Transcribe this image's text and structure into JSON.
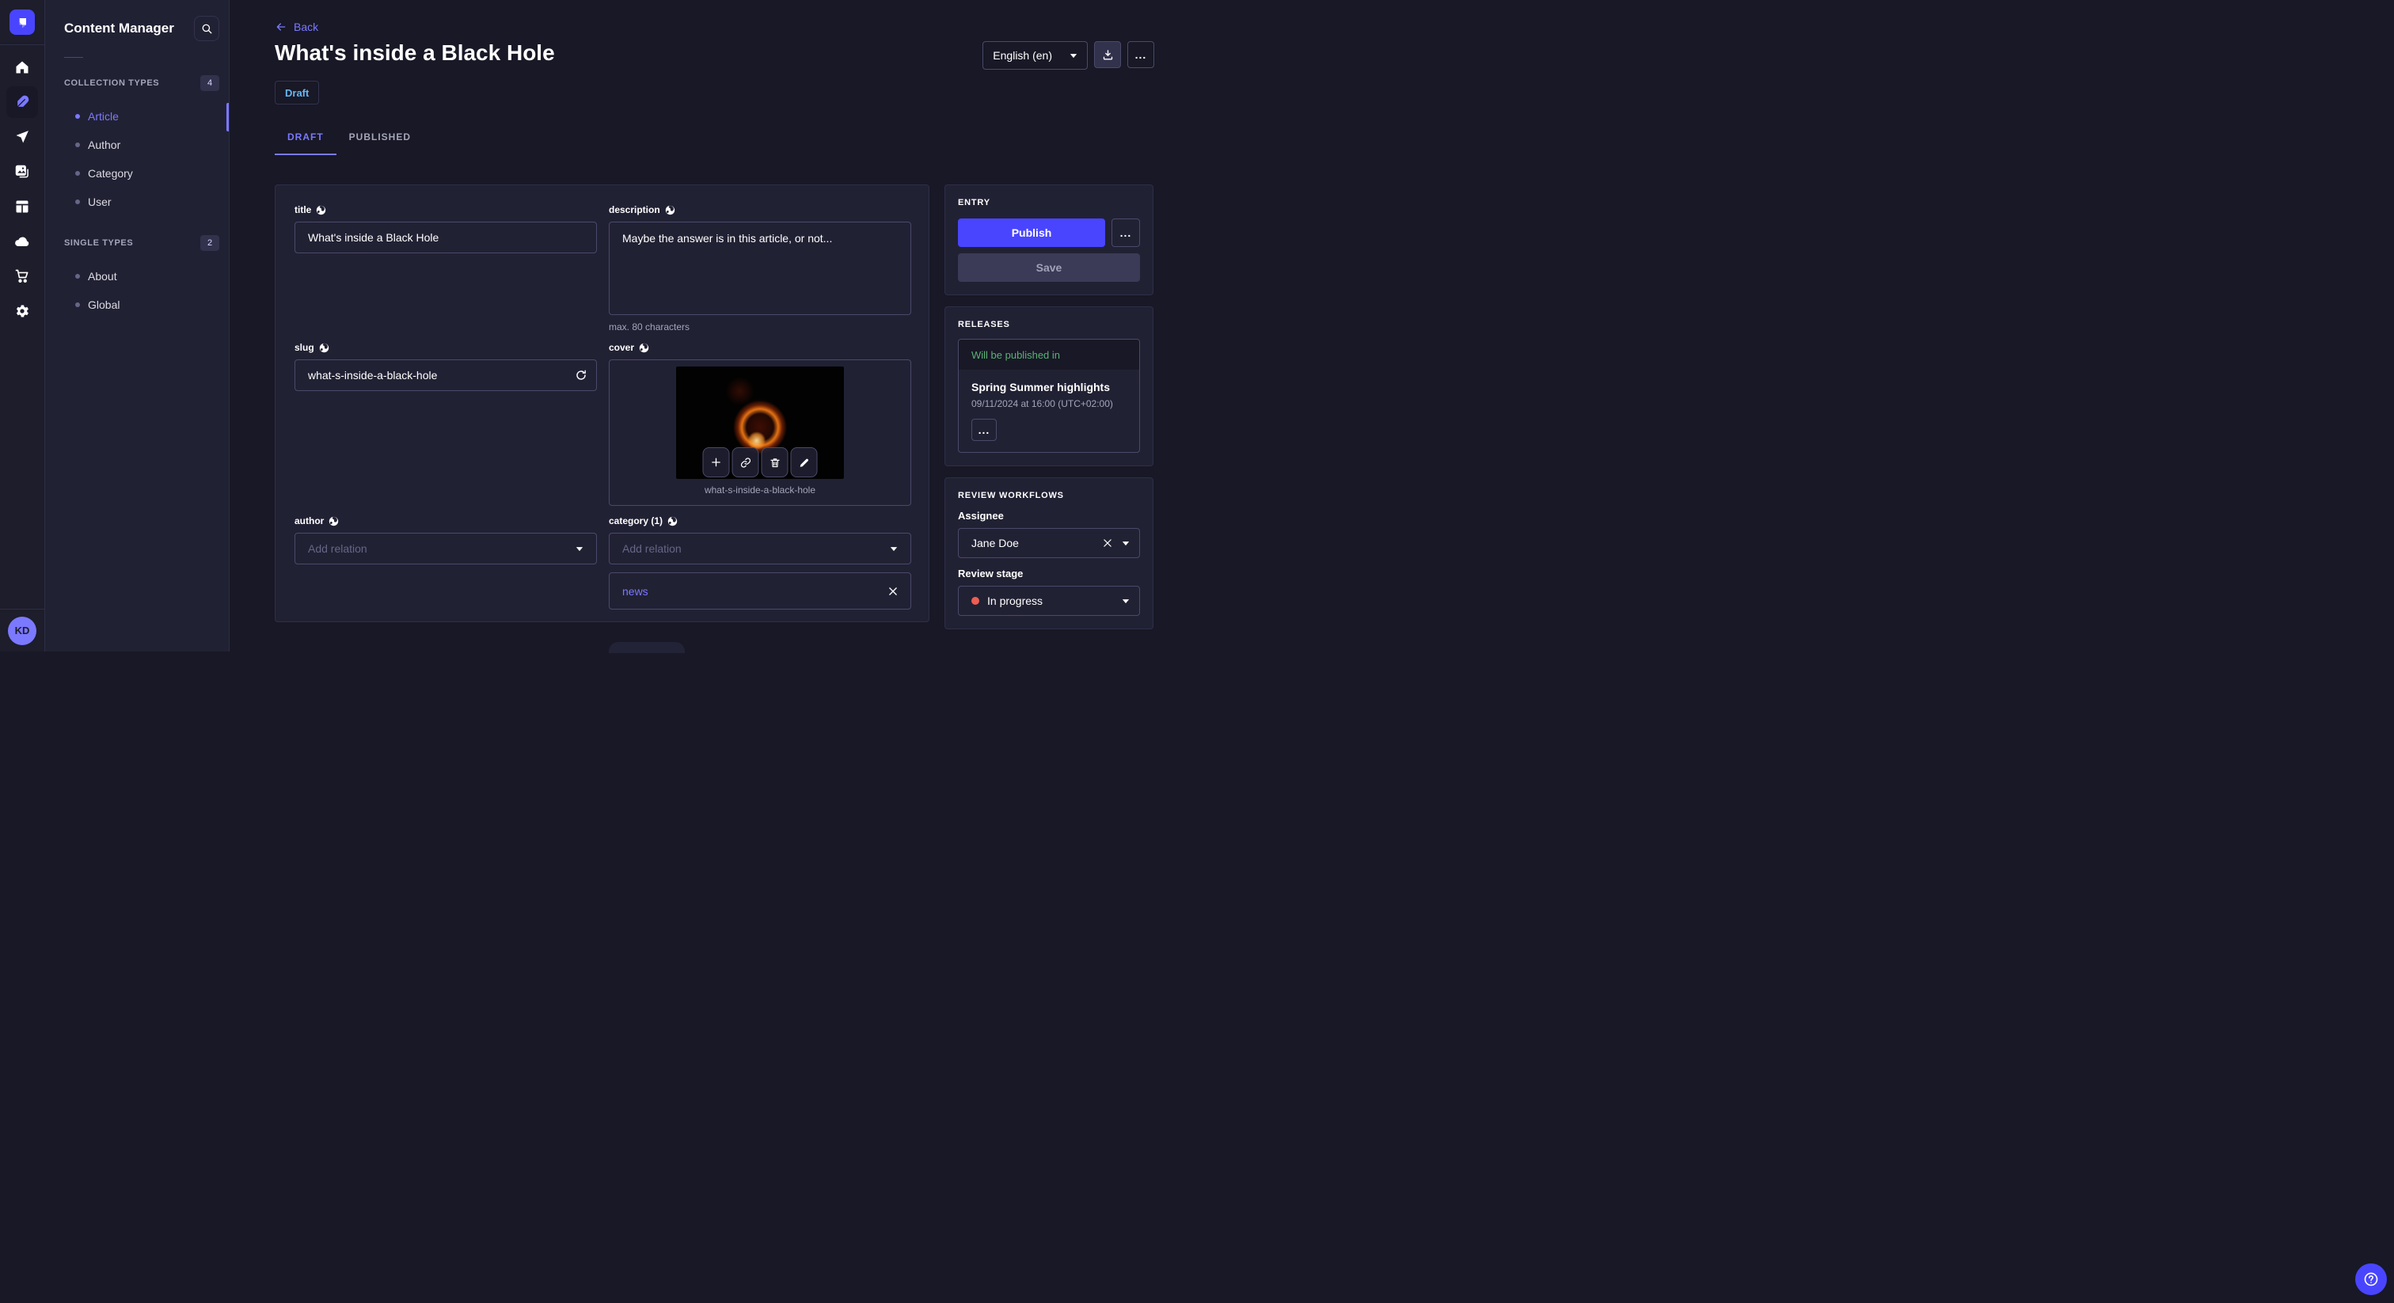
{
  "nav_rail": {
    "logo_icon": "strapi-logo",
    "items": [
      {
        "icon": "home-icon"
      },
      {
        "icon": "feather-icon",
        "active": true
      },
      {
        "icon": "paper-plane-icon"
      },
      {
        "icon": "media-library-icon"
      },
      {
        "icon": "content-type-builder-icon"
      },
      {
        "icon": "cloud-icon"
      },
      {
        "icon": "marketplace-cart-icon"
      },
      {
        "icon": "settings-gear-icon"
      }
    ],
    "user_initials": "KD"
  },
  "subnav": {
    "title": "Content Manager",
    "search_icon": "search-icon",
    "sections": [
      {
        "label": "COLLECTION TYPES",
        "count": "4",
        "items": [
          {
            "label": "Article",
            "active": true
          },
          {
            "label": "Author"
          },
          {
            "label": "Category"
          },
          {
            "label": "User"
          }
        ]
      },
      {
        "label": "SINGLE TYPES",
        "count": "2",
        "items": [
          {
            "label": "About"
          },
          {
            "label": "Global"
          }
        ]
      }
    ]
  },
  "header": {
    "back_label": "Back",
    "title": "What's inside a Black Hole",
    "status_badge": "Draft",
    "tabs": [
      {
        "label": "DRAFT",
        "active": true
      },
      {
        "label": "PUBLISHED",
        "active": false
      }
    ],
    "locale_select_value": "English (en)",
    "more_label": "...",
    "icons": [
      "download-icon",
      "more-horizontal-icon"
    ]
  },
  "form": {
    "title_field": {
      "label": "title",
      "value": "What's inside a Black Hole"
    },
    "description_field": {
      "label": "description",
      "value": "Maybe the answer is in this article, or not...",
      "hint": "max. 80 characters"
    },
    "slug_field": {
      "label": "slug",
      "value": "what-s-inside-a-black-hole"
    },
    "cover_field": {
      "label": "cover",
      "caption": "what-s-inside-a-black-hole",
      "toolbar_icons": [
        "plus-icon",
        "link-icon",
        "trash-icon",
        "pencil-icon"
      ]
    },
    "author_field": {
      "label": "author",
      "placeholder": "Add relation"
    },
    "category_field": {
      "label": "category (1)",
      "placeholder": "Add relation",
      "relations": [
        {
          "label": "news"
        }
      ]
    }
  },
  "entry_panel": {
    "title": "ENTRY",
    "publish_label": "Publish",
    "save_label": "Save",
    "more_label": "..."
  },
  "releases_panel": {
    "title": "RELEASES",
    "status": "Will be published in",
    "release_name": "Spring Summer highlights",
    "release_date": "09/11/2024 at 16:00 (UTC+02:00)",
    "more_label": "..."
  },
  "review_panel": {
    "title": "REVIEW WORKFLOWS",
    "assignee_label": "Assignee",
    "assignee_value": "Jane Doe",
    "stage_label": "Review stage",
    "stage_value": "In progress"
  },
  "colors": {
    "accent": "#4945ff",
    "accent_light": "#7b79ff",
    "status_draft": "#66b7f1",
    "success_green": "#5cb176",
    "stage_red": "#ee5e52",
    "page_bg": "#181826",
    "card_bg": "#212134"
  }
}
